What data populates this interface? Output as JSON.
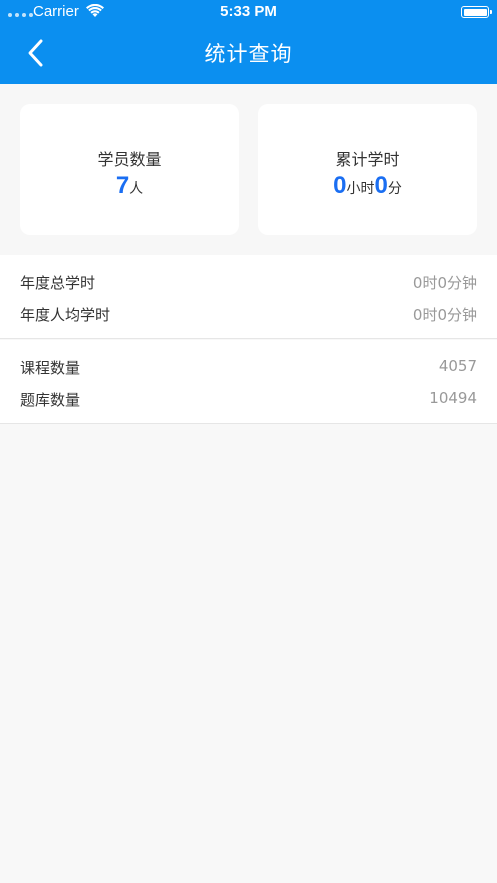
{
  "status_bar": {
    "carrier": "Carrier",
    "time": "5:33 PM"
  },
  "header": {
    "title": "统计查询"
  },
  "cards": {
    "students": {
      "label": "学员数量",
      "value": "7",
      "unit": "人"
    },
    "total_hours": {
      "label": "累计学时",
      "hours": "0",
      "hours_unit": "小时",
      "minutes": "0",
      "minutes_unit": "分"
    }
  },
  "stats_annual": [
    {
      "label": "年度总学时",
      "value": "0时0分钟"
    },
    {
      "label": "年度人均学时",
      "value": "0时0分钟"
    }
  ],
  "stats_counts": [
    {
      "label": "课程数量",
      "value": "4057"
    },
    {
      "label": "题库数量",
      "value": "10494"
    }
  ],
  "colors": {
    "header_bg": "#0b8ff0",
    "accent_number": "#1a6ef2",
    "page_bg": "#f8f8f8"
  }
}
